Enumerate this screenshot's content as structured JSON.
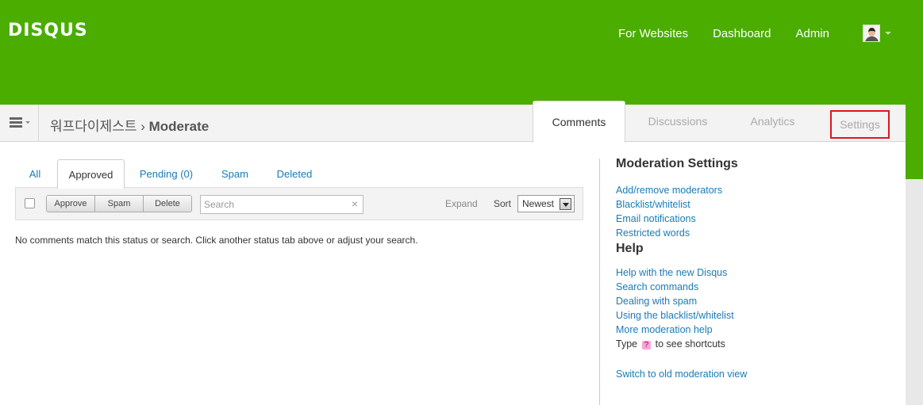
{
  "header": {
    "logo": "DISQUS",
    "nav": [
      "For Websites",
      "Dashboard",
      "Admin"
    ]
  },
  "subheader": {
    "site_name": "워프다이제스트",
    "separator": "›",
    "current": "Moderate"
  },
  "main_tabs": [
    "Comments",
    "Discussions",
    "Analytics",
    "Settings"
  ],
  "sub_tabs": [
    "All",
    "Approved",
    "Pending (0)",
    "Spam",
    "Deleted"
  ],
  "toolbar": {
    "approve": "Approve",
    "spam": "Spam",
    "delete": "Delete",
    "search_placeholder": "Search",
    "clear": "×",
    "expand": "Expand",
    "sort_label": "Sort",
    "sort_value": "Newest"
  },
  "empty_message": "No comments match this status or search. Click another status tab above or adjust your search.",
  "sidebar": {
    "moderation_title": "Moderation Settings",
    "moderation_links": [
      "Add/remove moderators",
      "Blacklist/whitelist",
      "Email notifications",
      "Restricted words"
    ],
    "help_title": "Help",
    "help_links": [
      "Help with the new Disqus",
      "Search commands",
      "Dealing with spam",
      "Using the blacklist/whitelist",
      "More moderation help"
    ],
    "shortcut_prefix": "Type",
    "shortcut_key": "?",
    "shortcut_suffix": "to see shortcuts",
    "old_view": "Switch to old moderation view"
  },
  "colors": {
    "brand_green": "#4aad00",
    "link_blue": "#1a7bb5",
    "highlight_red": "#e2141d"
  }
}
